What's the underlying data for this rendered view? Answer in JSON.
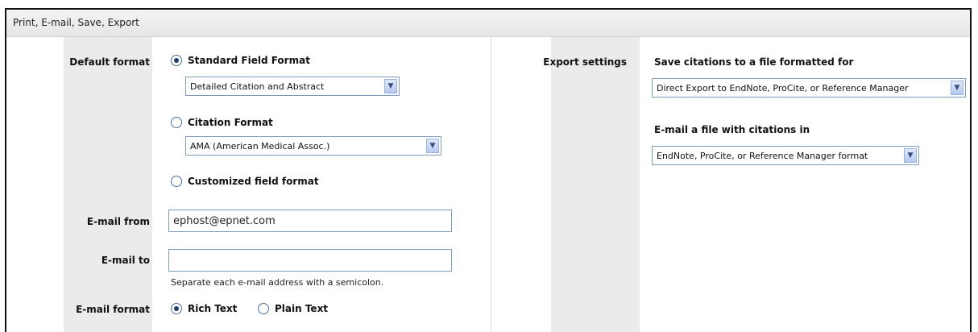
{
  "header": {
    "title": "Print, E-mail, Save, Export"
  },
  "left": {
    "default_format_label": "Default format",
    "options": {
      "standard": {
        "label": "Standard Field Format",
        "selected": true,
        "select_value": "Detailed Citation and Abstract"
      },
      "citation": {
        "label": "Citation Format",
        "selected": false,
        "select_value": "AMA (American Medical Assoc.)"
      },
      "custom": {
        "label": "Customized field format",
        "selected": false
      }
    },
    "email_from": {
      "label": "E-mail from",
      "value": "ephost@epnet.com"
    },
    "email_to": {
      "label": "E-mail to",
      "value": "",
      "hint": "Separate each e-mail address with a semicolon."
    },
    "email_format": {
      "label": "E-mail format",
      "rich": "Rich Text",
      "plain": "Plain Text",
      "selected": "rich"
    }
  },
  "right": {
    "export_settings_label": "Export settings",
    "save_heading": "Save citations to a file formatted for",
    "save_value": "Direct Export to EndNote, ProCite, or Reference Manager",
    "email_heading": "E-mail a file with citations in",
    "email_value": "EndNote, ProCite, or Reference Manager format"
  },
  "icons": {
    "dropdown": "chevron-down-icon",
    "radio_on": "radio-selected-icon",
    "radio_off": "radio-unselected-icon"
  }
}
